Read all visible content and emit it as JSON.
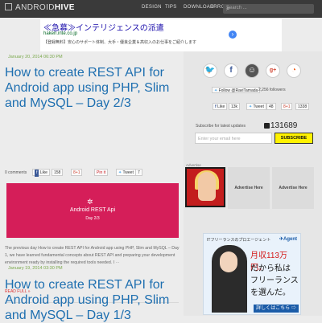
{
  "header": {
    "logo": {
      "brand_light": "ANDROID",
      "brand_bold": "HIVE"
    },
    "nav": [
      "DESIGN",
      "TIPS",
      "DOWNLOAD",
      "ERRORS"
    ],
    "search_placeholder": "Search ...",
    "colors": {
      "bar": "#3a3a3a"
    }
  },
  "top_ad": {
    "headline": "≪急募≫インテリジェンスの派遣",
    "url": "haken.inte.co.jp",
    "desc": "【登録無料】安心のサポート体制、大手・優良企業＆高収入のお仕事をご紹介します"
  },
  "posts": [
    {
      "date": "January 20, 2014 06:30 PM",
      "title": "How to create REST API for Android app using PHP, Slim and MySQL – Day 2/3",
      "comments": "0 comments",
      "share": {
        "like": "Like",
        "like_count": "158",
        "gplus": "8+1",
        "pinit": "Pin it",
        "tweet": "Tweet",
        "tweet_count": "7"
      },
      "banner": {
        "line1": "Android REST Api",
        "line2": "Day 2/3",
        "color": "#d51e59"
      },
      "excerpt": "The previous day How to create REST API for Android app using PHP, Slim and MySQL – Day 1, we have learned fundamental concepts about REST API and preparing your development environment ready by installing the required tools needed. I ⋯",
      "read_more": "READ FULL »"
    },
    {
      "date": "January 19, 2014 03:30 PM",
      "title": "How to create REST API for Android app using PHP, Slim and MySQL – Day 1/3"
    }
  ],
  "sidebar": {
    "social_icons": [
      "twitter-icon",
      "facebook-icon",
      "avatar-icon",
      "googleplus-icon",
      "rss-icon"
    ],
    "follow": {
      "label": "Follow @RaviTamada",
      "count": "2,256 followers"
    },
    "shares": [
      {
        "label": "Like",
        "count": "13k"
      },
      {
        "label": "Tweet",
        "count": "48"
      },
      {
        "label": "8+1",
        "count": "1338"
      }
    ],
    "subscribe_label": "Subscribe for latest updates",
    "subscriber_count": "131689",
    "email_placeholder": "Enter your email here",
    "subscribe_button": "SUBSCRIBE",
    "advertise_label": "Advertise",
    "advertise_slots": [
      "Advertise Here",
      "Advertise Here"
    ]
  },
  "side_ad": {
    "header": "ITフリーランスのプロエージェント",
    "brand": "✈Agent",
    "lines": [
      "月収113万円。",
      "だから私は",
      "フリーランス",
      "を選んだ。"
    ],
    "cta": "詳しくはこちら ⇨"
  }
}
